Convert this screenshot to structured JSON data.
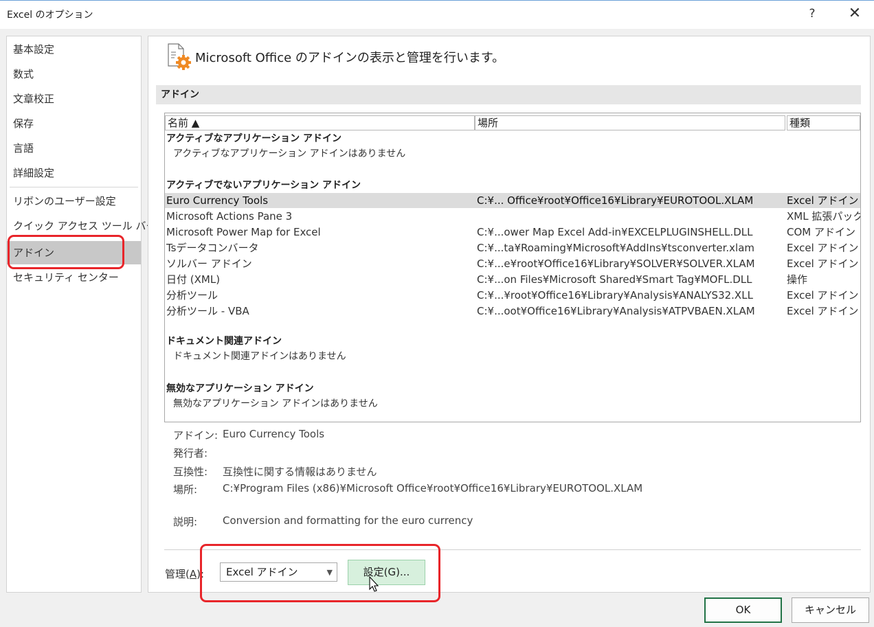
{
  "window": {
    "title": "Excel のオプション",
    "help": "?",
    "close": "✕"
  },
  "sidebar": {
    "items": [
      {
        "label": "基本設定"
      },
      {
        "label": "数式"
      },
      {
        "label": "文章校正"
      },
      {
        "label": "保存"
      },
      {
        "label": "言語"
      },
      {
        "label": "詳細設定"
      },
      {
        "label": "リボンのユーザー設定"
      },
      {
        "label": "クイック アクセス ツール バー"
      },
      {
        "label": "アドイン",
        "selected": true
      },
      {
        "label": "セキュリティ センター"
      }
    ]
  },
  "header": {
    "text": "Microsoft Office のアドインの表示と管理を行います。"
  },
  "section": {
    "title": "アドイン"
  },
  "table": {
    "columns": {
      "name": "名前 ▲",
      "location": "場所",
      "type": "種類"
    },
    "groups": [
      {
        "title": "アクティブなアプリケーション アドイン",
        "empty": "アクティブなアプリケーション アドインはありません"
      },
      {
        "title": "アクティブでないアプリケーション アドイン"
      },
      {
        "title": "ドキュメント関連アドイン",
        "empty": "ドキュメント関連アドインはありません"
      },
      {
        "title": "無効なアプリケーション アドイン",
        "empty": "無効なアプリケーション アドインはありません"
      }
    ],
    "rows": [
      {
        "name": "Euro Currency Tools",
        "location": "C:¥... Office¥root¥Office16¥Library¥EUROTOOL.XLAM",
        "type": "Excel アドイン",
        "selected": true
      },
      {
        "name": "Microsoft Actions Pane 3",
        "location": "",
        "type": "XML 拡張パック"
      },
      {
        "name": "Microsoft Power Map for Excel",
        "location": "C:¥...ower Map Excel Add-in¥EXCELPLUGINSHELL.DLL",
        "type": "COM アドイン"
      },
      {
        "name": "Tsデータコンバータ",
        "location": "C:¥...ta¥Roaming¥Microsoft¥AddIns¥tsconverter.xlam",
        "type": "Excel アドイン"
      },
      {
        "name": "ソルバー アドイン",
        "location": "C:¥...e¥root¥Office16¥Library¥SOLVER¥SOLVER.XLAM",
        "type": "Excel アドイン"
      },
      {
        "name": "日付 (XML)",
        "location": "C:¥...on Files¥Microsoft Shared¥Smart Tag¥MOFL.DLL",
        "type": "操作"
      },
      {
        "name": "分析ツール",
        "location": "C:¥...¥root¥Office16¥Library¥Analysis¥ANALYS32.XLL",
        "type": "Excel アドイン"
      },
      {
        "name": "分析ツール - VBA",
        "location": "C:¥...oot¥Office16¥Library¥Analysis¥ATPVBAEN.XLAM",
        "type": "Excel アドイン"
      }
    ]
  },
  "details": {
    "addin_label": "アドイン:",
    "addin_value": "Euro Currency Tools",
    "publisher_label": "発行者:",
    "publisher_value": "",
    "compat_label": "互換性:",
    "compat_value": "互換性に関する情報はありません",
    "location_label": "場所:",
    "location_value": "C:¥Program Files (x86)¥Microsoft Office¥root¥Office16¥Library¥EUROTOOL.XLAM",
    "description_label": "説明:",
    "description_value": "Conversion and formatting for the euro currency"
  },
  "manage": {
    "label_prefix": "管理(",
    "label_key": "A",
    "label_suffix": "):",
    "selected": "Excel アドイン",
    "go_label": "設定(G)..."
  },
  "footer": {
    "ok": "OK",
    "cancel": "キャンセル"
  },
  "colors": {
    "highlight": "#e8252a",
    "selected_nav": "#c8c8c8",
    "go_button": "#d7f0dd",
    "ok_border": "#217346"
  }
}
